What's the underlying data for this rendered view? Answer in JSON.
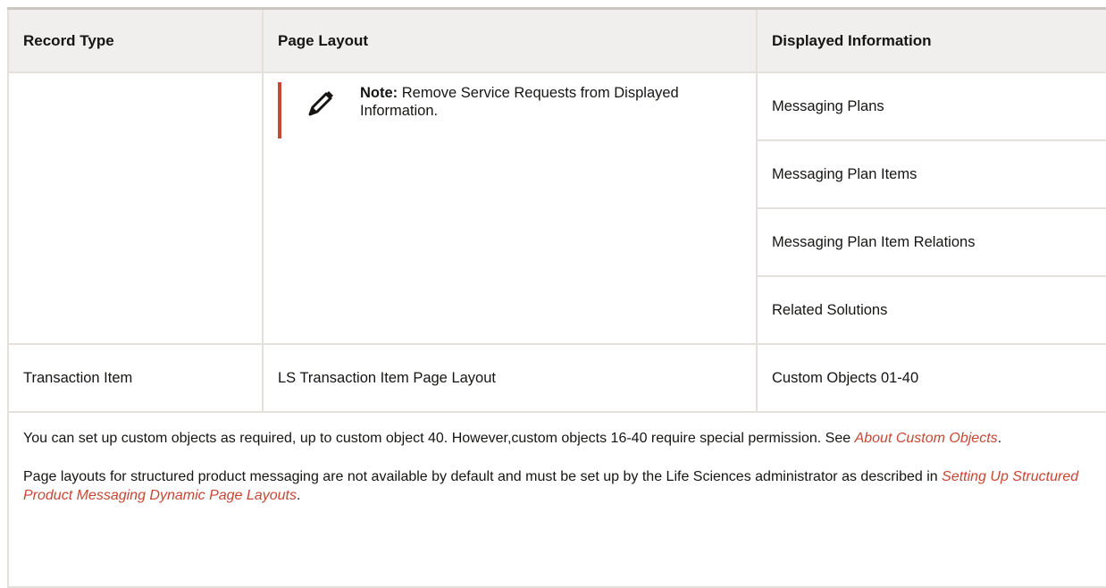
{
  "table": {
    "headers": [
      "Record Type",
      "Page Layout",
      "Displayed Information"
    ],
    "note": {
      "label": "Note:",
      "text": "Remove Service Requests from Displayed Information.",
      "icon": "pencil-icon",
      "accent_color": "#c74634"
    },
    "displayed_items": [
      "Messaging Plans",
      "Messaging Plan Items",
      "Messaging Plan Item Relations",
      "Related Solutions"
    ],
    "transaction_row": {
      "record_type": "Transaction Item",
      "page_layout": "LS Transaction Item Page Layout",
      "displayed_info": "Custom Objects 01-40"
    }
  },
  "footer": {
    "p1_text": "You can set up custom objects as required, up to custom object 40. However,custom objects 16-40 require special permission. See ",
    "p1_link": "About Custom Objects",
    "p1_end": ".",
    "p2_text": "Page layouts for structured product messaging are not available by default and must be set up by the Life Sciences administrator as described in ",
    "p2_link": "Setting Up Structured Product Messaging Dynamic Page Layouts",
    "p2_end": "."
  }
}
